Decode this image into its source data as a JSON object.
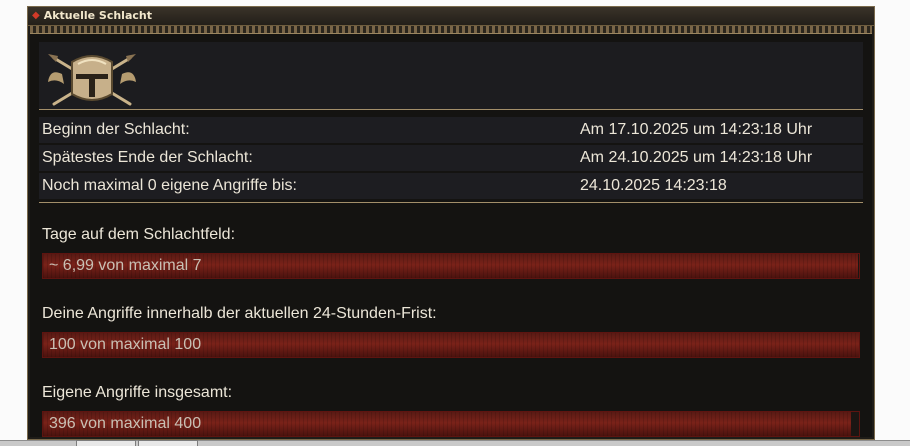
{
  "window": {
    "title": "Aktuelle Schlacht",
    "icon": "diamond-icon"
  },
  "emblem": {
    "icon": "crusader-helmet-emblem-icon"
  },
  "info_rows": [
    {
      "label": "Beginn der Schlacht:",
      "value": "Am 17.10.2025 um 14:23:18 Uhr"
    },
    {
      "label": "Spätestes Ende der Schlacht:",
      "value": "Am 24.10.2025 um 14:23:18 Uhr"
    },
    {
      "label": "Noch maximal 0 eigene Angriffe bis:",
      "value": "24.10.2025 14:23:18"
    }
  ],
  "stats": [
    {
      "label": "Tage auf dem Schlachtfeld:",
      "bar_text": "~ 6,99 von maximal 7",
      "fill": 0.9986
    },
    {
      "label": "Deine Angriffe innerhalb der aktuellen 24-Stunden-Frist:",
      "bar_text": "100 von maximal 100",
      "fill": 1.0
    },
    {
      "label": "Eigene Angriffe insgesamt:",
      "bar_text": "396 von maximal 400",
      "fill": 0.99
    }
  ],
  "colors": {
    "panel_bg": "#141311",
    "gold_border": "#a38f6a",
    "bar_red": "#7a2219",
    "text": "#ece6d8"
  }
}
